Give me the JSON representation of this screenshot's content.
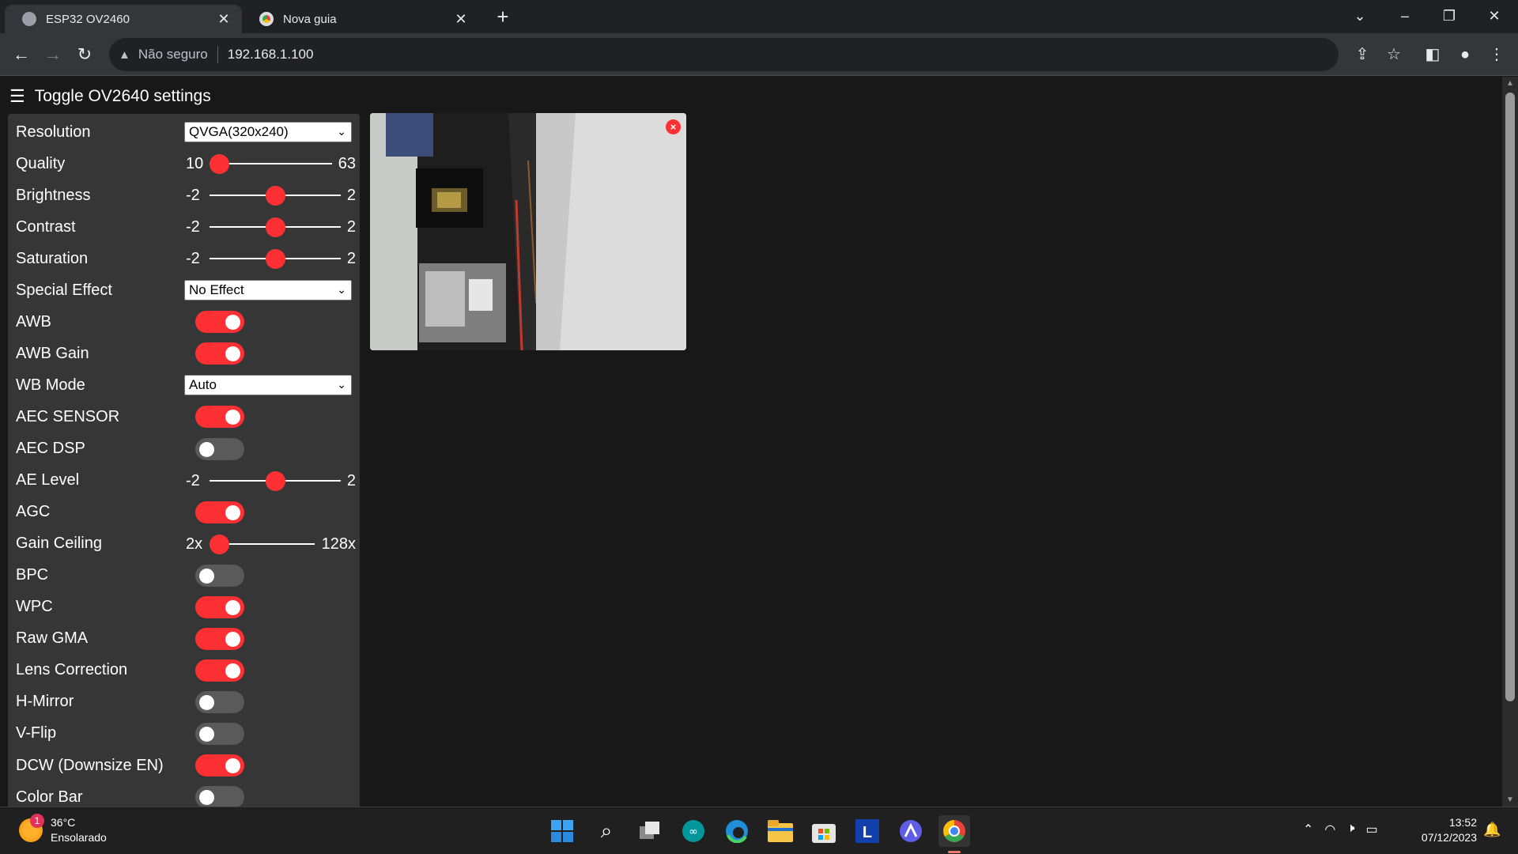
{
  "browser": {
    "tabs": [
      {
        "title": "ESP32 OV2460",
        "active": true
      },
      {
        "title": "Nova guia",
        "active": false
      }
    ],
    "new_tab_label": "+",
    "omnibox": {
      "security_label": "Não seguro",
      "url": "192.168.1.100"
    }
  },
  "page": {
    "toggle_label": "Toggle OV2640 settings",
    "close_stream_label": "×",
    "settings": [
      {
        "label": "Resolution",
        "type": "select",
        "value": "QVGA(320x240)"
      },
      {
        "label": "Quality",
        "type": "range",
        "min_label": "10",
        "max_label": "63",
        "level": 0.0
      },
      {
        "label": "Brightness",
        "type": "range",
        "min_label": "-2",
        "max_label": "2",
        "level": 0.5
      },
      {
        "label": "Contrast",
        "type": "range",
        "min_label": "-2",
        "max_label": "2",
        "level": 0.5
      },
      {
        "label": "Saturation",
        "type": "range",
        "min_label": "-2",
        "max_label": "2",
        "level": 0.5
      },
      {
        "label": "Special Effect",
        "type": "select",
        "value": "No Effect"
      },
      {
        "label": "AWB",
        "type": "toggle",
        "on": true
      },
      {
        "label": "AWB Gain",
        "type": "toggle",
        "on": true
      },
      {
        "label": "WB Mode",
        "type": "select",
        "value": "Auto"
      },
      {
        "label": "AEC SENSOR",
        "type": "toggle",
        "on": true
      },
      {
        "label": "AEC DSP",
        "type": "toggle",
        "on": false
      },
      {
        "label": "AE Level",
        "type": "range",
        "min_label": "-2",
        "max_label": "2",
        "level": 0.5
      },
      {
        "label": "AGC",
        "type": "toggle",
        "on": true
      },
      {
        "label": "Gain Ceiling",
        "type": "range",
        "min_label": "2x",
        "max_label": "128x",
        "level": 0.0
      },
      {
        "label": "BPC",
        "type": "toggle",
        "on": false
      },
      {
        "label": "WPC",
        "type": "toggle",
        "on": true
      },
      {
        "label": "Raw GMA",
        "type": "toggle",
        "on": true
      },
      {
        "label": "Lens Correction",
        "type": "toggle",
        "on": true
      },
      {
        "label": "H-Mirror",
        "type": "toggle",
        "on": false
      },
      {
        "label": "V-Flip",
        "type": "toggle",
        "on": false
      },
      {
        "label": "DCW (Downsize EN)",
        "type": "toggle",
        "on": true
      },
      {
        "label": "Color Bar",
        "type": "toggle",
        "on": false
      }
    ]
  },
  "taskbar": {
    "weather": {
      "badge": "1",
      "temp": "36°C",
      "condition": "Ensolarado"
    },
    "apps": [
      "windows-start-icon",
      "search-icon",
      "task-view-icon",
      "arduino-icon",
      "edge-icon",
      "file-explorer-icon",
      "store-icon",
      "l-app-icon",
      "app-icon",
      "chrome-icon"
    ],
    "clock": {
      "time": "13:52",
      "date": "07/12/2023"
    }
  },
  "colors": {
    "accent": "#ff3034",
    "panel": "#363636",
    "background": "#181818"
  }
}
